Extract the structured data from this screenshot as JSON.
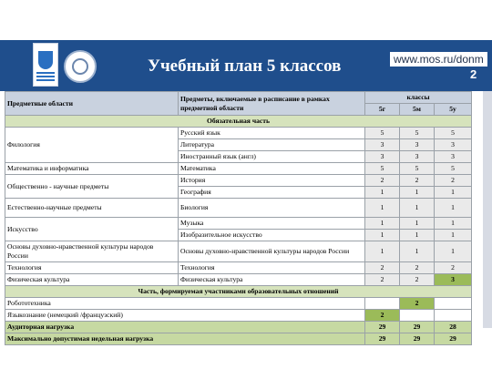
{
  "header": {
    "title": "Учебный план 5 классов",
    "url": "www.mos.ru/donm",
    "page_number": "2"
  },
  "table": {
    "head": {
      "areas": "Предметные области",
      "subjects": "Предметы, включаемые в расписание в рамках предметной области",
      "classes": "классы",
      "class_names": [
        "5г",
        "5м",
        "5у"
      ]
    },
    "section_mandatory": "Обязательная часть",
    "rows": [
      {
        "area": "Филология",
        "subject": "Русский язык",
        "v": [
          "5",
          "5",
          "5"
        ]
      },
      {
        "subject": "Литература",
        "v": [
          "3",
          "3",
          "3"
        ]
      },
      {
        "subject": "Иностранный язык (англ)",
        "v": [
          "3",
          "3",
          "3"
        ]
      },
      {
        "area": "Математика и информатика",
        "subject": "Математика",
        "v": [
          "5",
          "5",
          "5"
        ]
      },
      {
        "area": "Общественно - научные предметы",
        "subject": "История",
        "v": [
          "2",
          "2",
          "2"
        ]
      },
      {
        "subject": "География",
        "v": [
          "1",
          "1",
          "1"
        ]
      },
      {
        "area": "Естественно-научные предметы",
        "subject": "Биология",
        "v": [
          "1",
          "1",
          "1"
        ]
      },
      {
        "area": "Искусство",
        "subject": "Музыка",
        "v": [
          "1",
          "1",
          "1"
        ]
      },
      {
        "subject": "Изобразительное искусство",
        "v": [
          "1",
          "1",
          "1"
        ]
      },
      {
        "area": "Основы духовно-нравственной культуры народов России",
        "subject": "Основы духовно-нравственной культуры народов России",
        "v": [
          "1",
          "1",
          "1"
        ]
      },
      {
        "area": "Технология",
        "subject": "Технология",
        "v": [
          "2",
          "2",
          "2"
        ]
      },
      {
        "area": "Физическая культура",
        "subject": "Физическая культура",
        "v": [
          "2",
          "2",
          "3"
        ]
      }
    ],
    "section_optional": "Часть, формируемая участниками образовательных отношений",
    "optional_rows": [
      {
        "label": "Робототехника",
        "v": [
          "",
          "2",
          ""
        ]
      },
      {
        "label": "Языкознание (немецкий /французский)",
        "v": [
          "2",
          "",
          ""
        ]
      }
    ],
    "totals": [
      {
        "label": "Аудиторная нагрузка",
        "v": [
          "29",
          "29",
          "28"
        ]
      },
      {
        "label": "Максимально допустимая недельная нагрузка",
        "v": [
          "29",
          "29",
          "29"
        ]
      }
    ],
    "colors": {
      "header": "#c9d2df",
      "section": "#d6e3bc",
      "highlight": "#9bbb59",
      "banner": "#1f4e8c"
    }
  }
}
